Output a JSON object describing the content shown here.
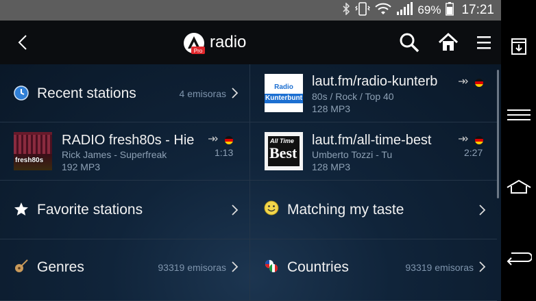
{
  "status": {
    "battery": "69%",
    "time": "17:21"
  },
  "header": {
    "title": "radio"
  },
  "recent": {
    "label": "Recent stations",
    "count": "4 emisoras"
  },
  "station1": {
    "name": "RADIO fresh80s - Hie",
    "track": "Rick James - Superfreak",
    "quality": "192 MP3",
    "time": "1:13",
    "logo_text": "fresh80s"
  },
  "station2": {
    "name": "laut.fm/radio-kunterb",
    "genre": "80s / Rock / Top 40",
    "quality": "128 MP3",
    "logo_text_1": "Radio",
    "logo_text_2": "Kunterbunt"
  },
  "station3": {
    "name": "laut.fm/all-time-best",
    "track": "Umberto Tozzi - Tu",
    "quality": "128 MP3",
    "time": "2:27",
    "logo_text_1": "All Time",
    "logo_text_2": "Best"
  },
  "favorites": {
    "label": "Favorite stations"
  },
  "taste": {
    "label": "Matching my taste"
  },
  "genres": {
    "label": "Genres",
    "count": "93319 emisoras"
  },
  "countries": {
    "label": "Countries",
    "count": "93319 emisoras"
  },
  "colors": {
    "accent": "#e0262b",
    "background": "#10243a"
  }
}
